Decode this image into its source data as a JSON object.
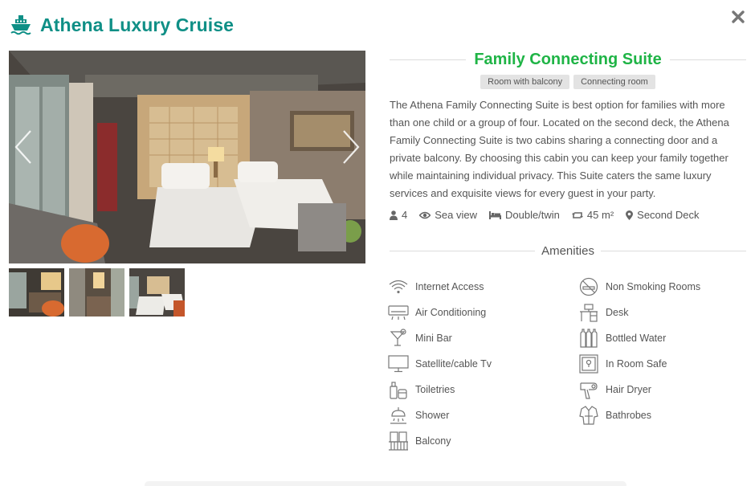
{
  "header": {
    "title": "Athena Luxury Cruise",
    "icon": "ship-icon"
  },
  "close": {
    "icon": "close-icon"
  },
  "gallery": {
    "thumbnails": [
      "thumb-1",
      "thumb-2",
      "thumb-3"
    ]
  },
  "room": {
    "title": "Family Connecting Suite",
    "tags": [
      "Room with balcony",
      "Connecting room"
    ],
    "description": "The Athena Family Connecting Suite is best option for families with more than one child or a group of four.  Located on the second deck, the Athena Family Connecting Suite is two cabins sharing a connecting door and a private balcony.  By choosing this cabin you can keep your family together while maintaining individual privacy.  This Suite caters the same luxury services and exquisite views for every guest in your party.",
    "facts": {
      "guests": "4",
      "view": "Sea view",
      "bed": "Double/twin",
      "size": "45 m²",
      "deck": "Second Deck"
    }
  },
  "amenities": {
    "title": "Amenities",
    "left": [
      {
        "label": "Internet Access",
        "icon": "wifi-icon"
      },
      {
        "label": "Air Conditioning",
        "icon": "air-conditioner-icon"
      },
      {
        "label": "Mini Bar",
        "icon": "cocktail-icon"
      },
      {
        "label": "Satellite/cable Tv",
        "icon": "tv-icon"
      },
      {
        "label": "Toiletries",
        "icon": "toiletries-icon"
      },
      {
        "label": "Shower",
        "icon": "shower-icon"
      },
      {
        "label": "Balcony",
        "icon": "balcony-icon"
      }
    ],
    "right": [
      {
        "label": "Non Smoking Rooms",
        "icon": "no-smoking-icon"
      },
      {
        "label": "Desk",
        "icon": "desk-icon"
      },
      {
        "label": "Bottled Water",
        "icon": "bottles-icon"
      },
      {
        "label": "In Room Safe",
        "icon": "safe-icon"
      },
      {
        "label": "Hair Dryer",
        "icon": "hair-dryer-icon"
      },
      {
        "label": "Bathrobes",
        "icon": "bathrobe-icon"
      }
    ]
  },
  "colors": {
    "brand": "#0f8f86",
    "room_title": "#1fb446"
  }
}
